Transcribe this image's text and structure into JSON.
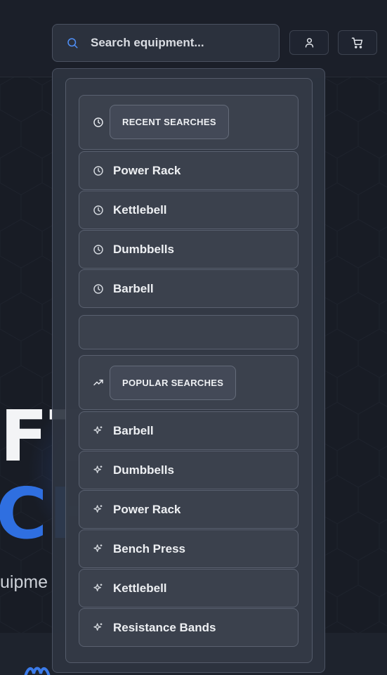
{
  "search": {
    "placeholder": "Search equipment..."
  },
  "header_icons": {
    "account": "user-icon",
    "cart": "cart-icon"
  },
  "hero": {
    "line1": "FT",
    "line2": "CHA",
    "subtitle": "uipme"
  },
  "dropdown": {
    "recent": {
      "heading": "RECENT SEARCHES",
      "icon": "clock-icon",
      "items": [
        "Power Rack",
        "Kettlebell",
        "Dumbbells",
        "Barbell"
      ]
    },
    "popular": {
      "heading": "POPULAR SEARCHES",
      "icon": "trending-up-icon",
      "items": [
        "Barbell",
        "Dumbbells",
        "Power Rack",
        "Bench Press",
        "Kettlebell",
        "Resistance Bands"
      ]
    }
  },
  "colors": {
    "accent": "#2f6fe0",
    "background": "#181c25",
    "panel": "#3b414d"
  }
}
